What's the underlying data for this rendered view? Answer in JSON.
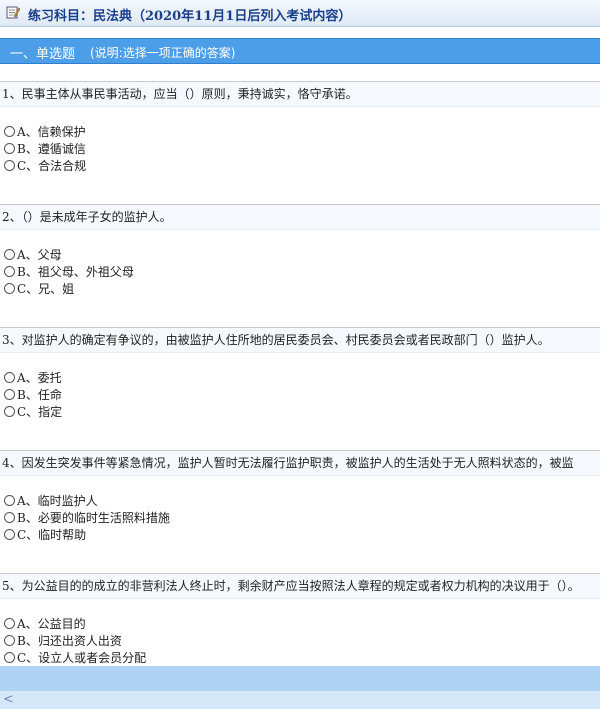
{
  "header": {
    "title": "练习科目：民法典（2020年11月1日后列入考试内容）",
    "icon": "edit-icon"
  },
  "section": {
    "title": "一、单选题",
    "note": "(说明:选择一项正确的答案)"
  },
  "questions": [
    {
      "text": "1、民事主体从事民事活动，应当（）原则，秉持诚实，恪守承诺。",
      "options": [
        "A、信赖保护",
        "B、遵循诚信",
        "C、合法合规"
      ]
    },
    {
      "text": "2、（）是未成年子女的监护人。",
      "options": [
        "A、父母",
        "B、祖父母、外祖父母",
        "C、兄、姐"
      ]
    },
    {
      "text": "3、对监护人的确定有争议的，由被监护人住所地的居民委员会、村民委员会或者民政部门（）监护人。",
      "options": [
        "A、委托",
        "B、任命",
        "C、指定"
      ]
    },
    {
      "text": "4、因发生突发事件等紧急情况，监护人暂时无法履行监护职责，被监护人的生活处于无人照料状态的，被监",
      "options": [
        "A、临时监护人",
        "B、必要的临时生活照料措施",
        "C、临时帮助"
      ]
    },
    {
      "text": "5、为公益目的的成立的非营利法人终止时，剩余财产应当按照法人章程的规定或者权力机构的决议用于（）。",
      "options": [
        "A、公益目的",
        "B、归还出资人出资",
        "C、设立人或者会员分配"
      ]
    }
  ],
  "scrollbar": {
    "left_arrow": "<"
  }
}
